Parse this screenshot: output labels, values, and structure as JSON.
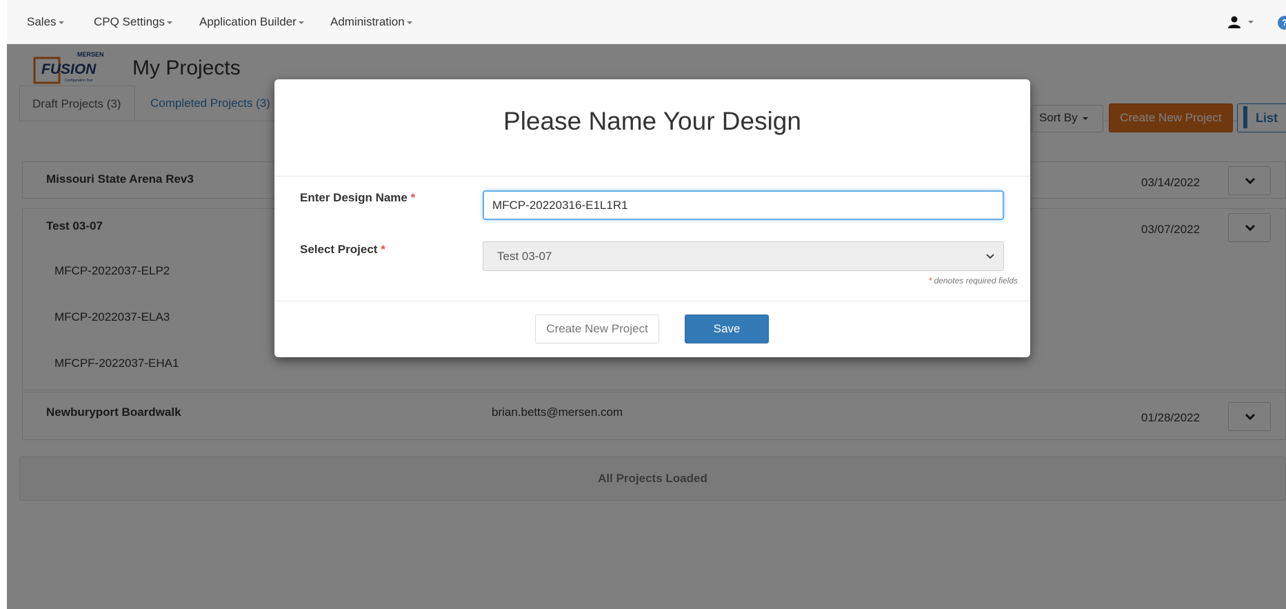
{
  "nav": {
    "items": [
      "Sales",
      "CPQ Settings",
      "Application Builder",
      "Administration"
    ],
    "help_glyph": "?"
  },
  "brand": {
    "logo_top": "MERSEN",
    "logo_main": "FUSION",
    "logo_sub": "Configuration Tool",
    "accent": "#e0701e"
  },
  "page": {
    "title": "My Projects",
    "tab_draft": "Draft Projects (3)",
    "tab_completed": "Completed Projects (3)",
    "sort_label": "Sort By",
    "create_label": "Create New Project",
    "list_label": "List"
  },
  "projects": [
    {
      "name": "Missouri State Arena Rev3",
      "owner": "",
      "date": "03/14/2022",
      "designs": []
    },
    {
      "name": "Test 03-07",
      "owner": "",
      "date": "03/07/2022",
      "designs": [
        "MFCP-2022037-ELP2",
        "MFCP-2022037-ELA3",
        "MFCPF-2022037-EHA1"
      ]
    },
    {
      "name": "Newburyport Boardwalk",
      "owner": "brian.betts@mersen.com",
      "date": "01/28/2022",
      "designs": []
    }
  ],
  "loaded_label": "All Projects Loaded",
  "modal": {
    "title": "Please Name Your Design",
    "name_label": "Enter Design Name",
    "name_value": "MFCP-20220316-E1L1R1",
    "project_label": "Select Project",
    "project_value": "Test 03-07",
    "required_mark": "*",
    "required_note": "denotes required fields",
    "create_button": "Create New Project",
    "save_button": "Save"
  }
}
